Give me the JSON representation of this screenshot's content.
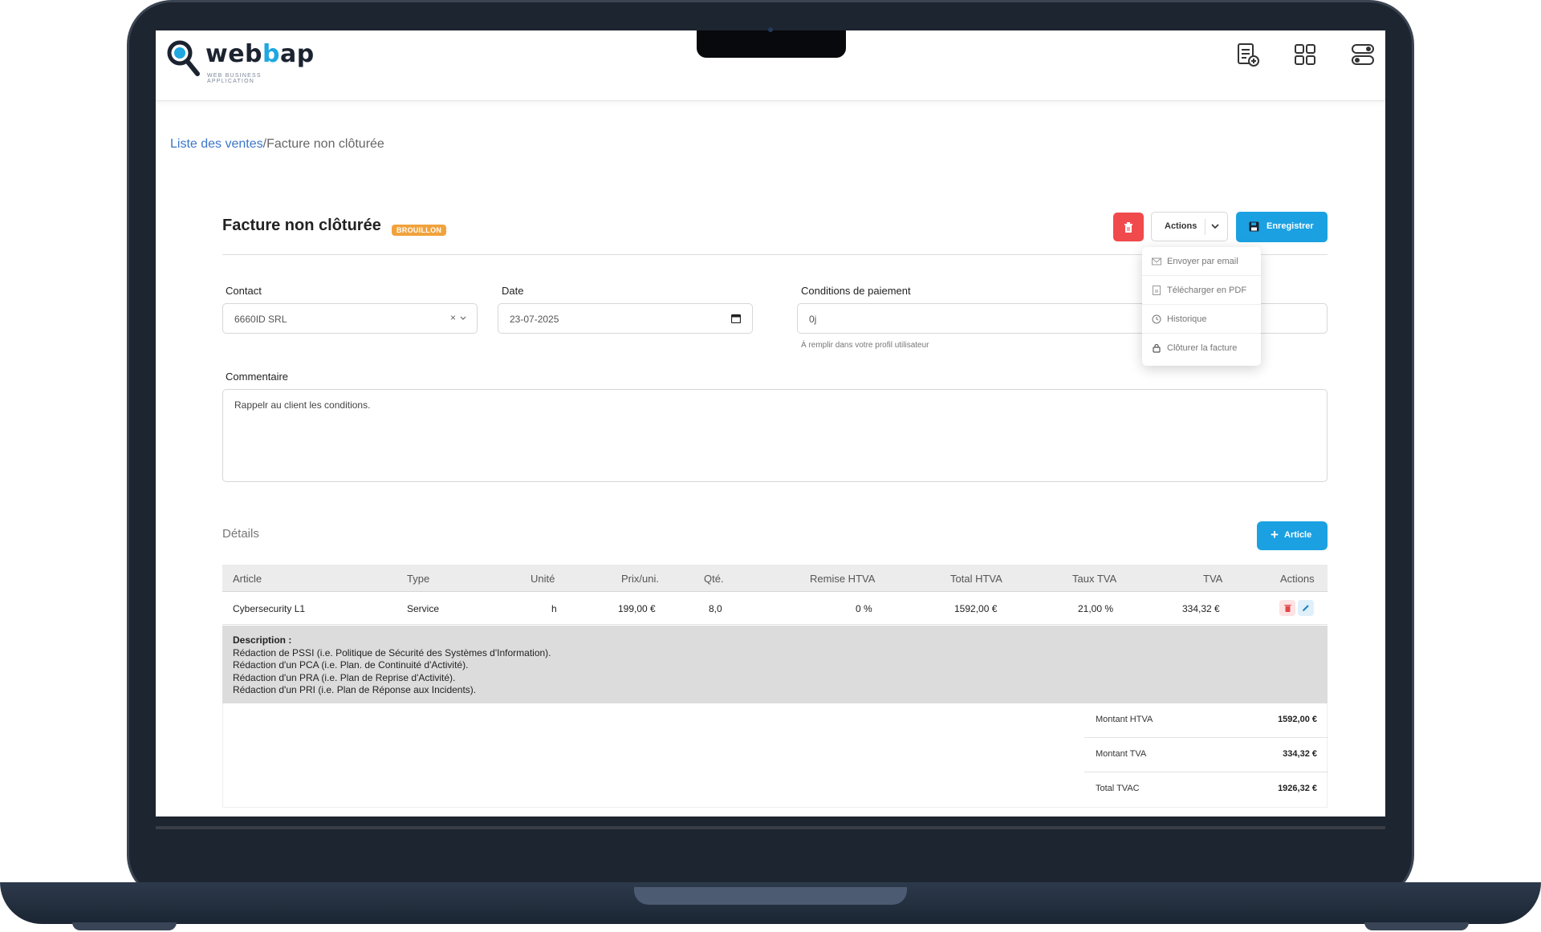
{
  "header": {
    "logo_text_a": "web",
    "logo_text_b": "b",
    "logo_text_c": "ap",
    "logo_subtitle": "WEB BUSINESS APPLICATION",
    "icons": [
      "new-document-icon",
      "grid-icon",
      "toggles-icon"
    ]
  },
  "breadcrumb": {
    "parent": "Liste des ventes",
    "separator": "/",
    "current": "Facture non clôturée"
  },
  "page": {
    "title": "Facture non clôturée",
    "badge": "BROUILLON",
    "actions_label": "Actions",
    "save_label": "Enregistrer"
  },
  "actions_menu": {
    "items": [
      {
        "label": "Envoyer par email",
        "icon": "mail-icon"
      },
      {
        "label": "Télécharger en PDF",
        "icon": "pdf-icon"
      },
      {
        "label": "Historique",
        "icon": "history-icon"
      },
      {
        "label": "Clôturer la facture",
        "icon": "lock-icon"
      }
    ]
  },
  "form": {
    "contact_label": "Contact",
    "contact_value": "6660ID SRL",
    "date_label": "Date",
    "date_value": "23-07-2025",
    "conditions_label": "Conditions de paiement",
    "conditions_value": "0j",
    "conditions_hint": "À remplir dans votre profil utilisateur",
    "comment_label": "Commentaire",
    "comment_value": "Rappelr au client les conditions."
  },
  "details": {
    "title": "Détails",
    "add_article_label": "Article",
    "columns": [
      "Article",
      "Type",
      "Unité",
      "Prix/uni.",
      "Qté.",
      "Remise HTVA",
      "Total HTVA",
      "Taux TVA",
      "TVA",
      "Actions"
    ],
    "rows": [
      {
        "article": "Cybersecurity L1",
        "type": "Service",
        "unit": "h",
        "unit_price": "199,00 €",
        "qty": "8,0",
        "discount": "0 %",
        "total_htva": "1592,00 €",
        "vat_rate": "21,00 %",
        "vat": "334,32 €"
      }
    ],
    "description": {
      "heading": "Description :",
      "lines": [
        "Rédaction de PSSI (i.e. Politique de Sécurité des Systèmes d'Information).",
        "Rédaction d'un PCA (i.e. Plan. de Continuité d'Activité).",
        "Rédaction d'un PRA (i.e. Plan de Reprise d'Activité).",
        "Rédaction d'un PRI (i.e. Plan de Réponse aux Incidents)."
      ]
    }
  },
  "summary": {
    "htva_label": "Montant HTVA",
    "htva_value": "1592,00 €",
    "tva_label": "Montant TVA",
    "tva_value": "334,32  €",
    "total_label": "Total TVAC",
    "total_value": "1926,32 €"
  },
  "colors": {
    "primary": "#1ba1e2",
    "danger": "#f04a4d",
    "badge": "#f1a23c",
    "link": "#3a77c9"
  }
}
